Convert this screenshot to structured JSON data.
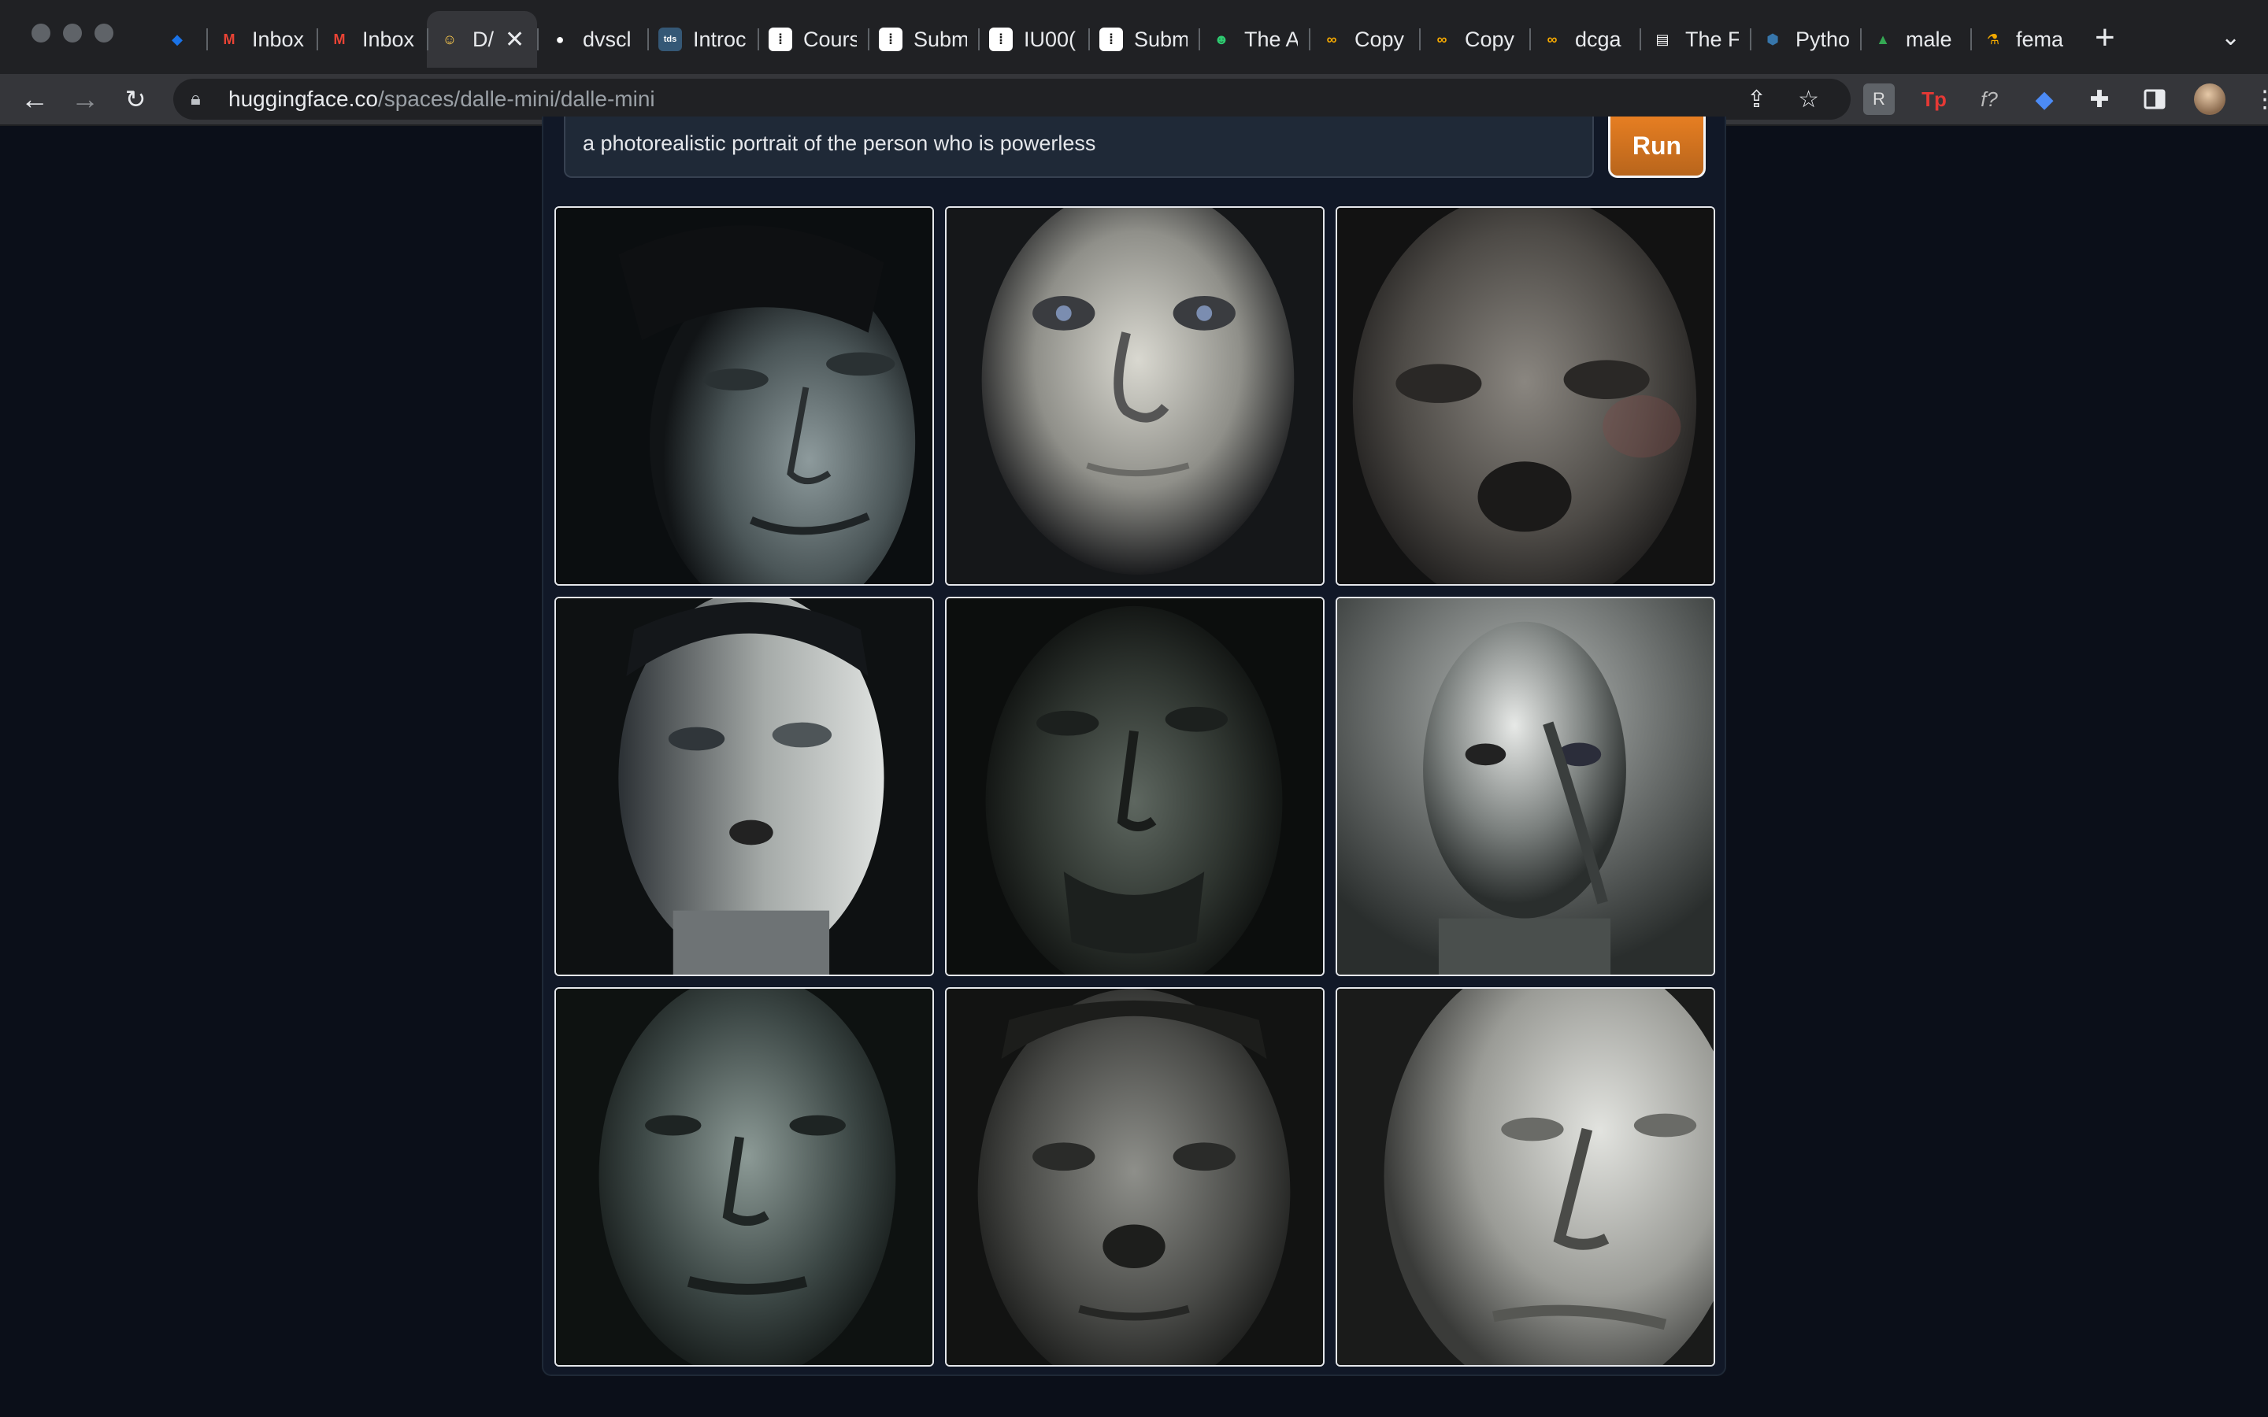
{
  "browser": {
    "tabs": [
      {
        "title": "",
        "icon": "gem-icon",
        "color": "#1a73e8"
      },
      {
        "title": "Inbox",
        "icon": "gmail-icon",
        "color": "#ea4335"
      },
      {
        "title": "Inbox",
        "icon": "gmail-icon",
        "color": "#ea4335"
      },
      {
        "title": "D/",
        "icon": "hugging-face-icon",
        "color": "#ffcc4d",
        "active": true
      },
      {
        "title": "dvscl",
        "icon": "github-icon",
        "color": "#ffffff"
      },
      {
        "title": "Introc",
        "icon": "tds-icon",
        "color": "#355876"
      },
      {
        "title": "Cours",
        "icon": "course-icon",
        "color": "#111111"
      },
      {
        "title": "Subm",
        "icon": "course-icon",
        "color": "#111111"
      },
      {
        "title": "IU00(",
        "icon": "course-icon",
        "color": "#111111"
      },
      {
        "title": "Subm",
        "icon": "course-icon",
        "color": "#111111"
      },
      {
        "title": "The A",
        "icon": "robot-icon",
        "color": "#2ecc71"
      },
      {
        "title": "Copy",
        "icon": "colab-icon",
        "color": "#f9ab00"
      },
      {
        "title": "Copy",
        "icon": "colab-icon",
        "color": "#f9ab00"
      },
      {
        "title": "dcga",
        "icon": "colab-icon",
        "color": "#f9ab00"
      },
      {
        "title": "The F",
        "icon": "paper-icon",
        "color": "#ffffff"
      },
      {
        "title": "Pytho",
        "icon": "python-icon",
        "color": "#3776ab"
      },
      {
        "title": "male",
        "icon": "drive-icon",
        "color": "#34a853"
      },
      {
        "title": "fema",
        "icon": "flask-icon",
        "color": "#f2a900"
      }
    ],
    "url_host": "huggingface.co",
    "url_path": "/spaces/dalle-mini/dalle-mini"
  },
  "app": {
    "prompt_value": "a photorealistic portrait of the person who is powerless",
    "run_label": "Run",
    "accent": "#e67e22",
    "images_count": 9
  }
}
